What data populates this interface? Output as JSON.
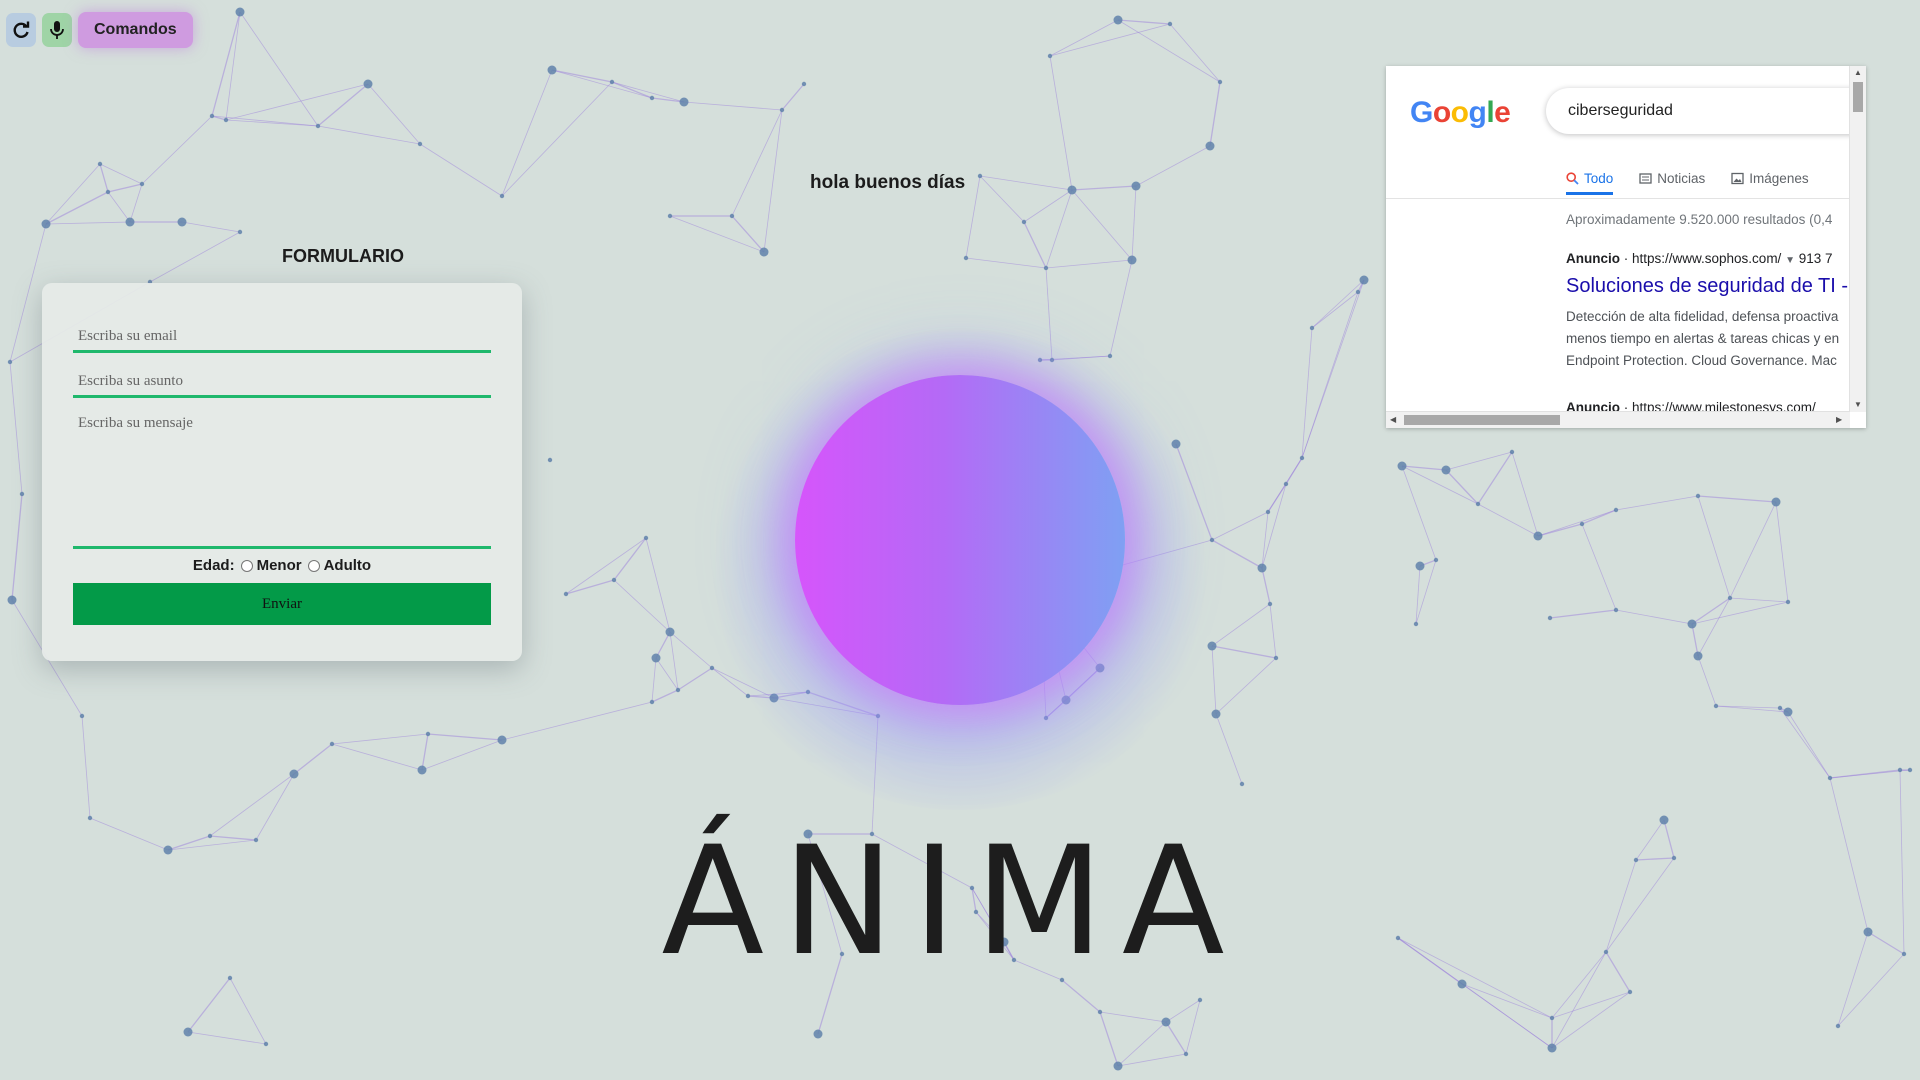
{
  "toolbar": {
    "refresh_icon": "refresh-icon",
    "mic_icon": "microphone-icon",
    "commands_label": "Comandos"
  },
  "greeting": "hola buenos días",
  "form": {
    "title": "FORMULARIO",
    "email_placeholder": "Escriba su email",
    "subject_placeholder": "Escriba su asunto",
    "message_placeholder": "Escriba su mensaje",
    "age_label": "Edad:",
    "age_option_minor": "Menor",
    "age_option_adult": "Adulto",
    "submit_label": "Enviar",
    "accent_color": "#1fb86c",
    "button_color": "#039a48"
  },
  "brand": {
    "name": "ÁNIMA"
  },
  "orb": {
    "colors": [
      "#d655fb",
      "#b46af6",
      "#7fa0f3"
    ]
  },
  "google": {
    "logo_text": "Google",
    "search_value": "ciberseguridad",
    "tabs": [
      {
        "label": "Todo",
        "icon": "search-icon",
        "active": true
      },
      {
        "label": "Noticias",
        "icon": "news-icon",
        "active": false
      },
      {
        "label": "Imágenes",
        "icon": "image-icon",
        "active": false
      }
    ],
    "result_count": "Aproximadamente 9.520.000 resultados (0,4",
    "ad_label": "Anuncio",
    "ad_url": "https://www.sophos.com/",
    "ad_phone": "913 7",
    "ad_title": "Soluciones de seguridad de TI -",
    "ad_desc_lines": [
      "Detección de alta fidelidad, defensa proactiva",
      "menos tiempo en alertas & tareas chicas y en",
      "Endpoint Protection. Cloud Governance. Mac"
    ],
    "next_ad_label": "Anuncio",
    "next_ad_url": "https://www.milestonesys.com/"
  }
}
